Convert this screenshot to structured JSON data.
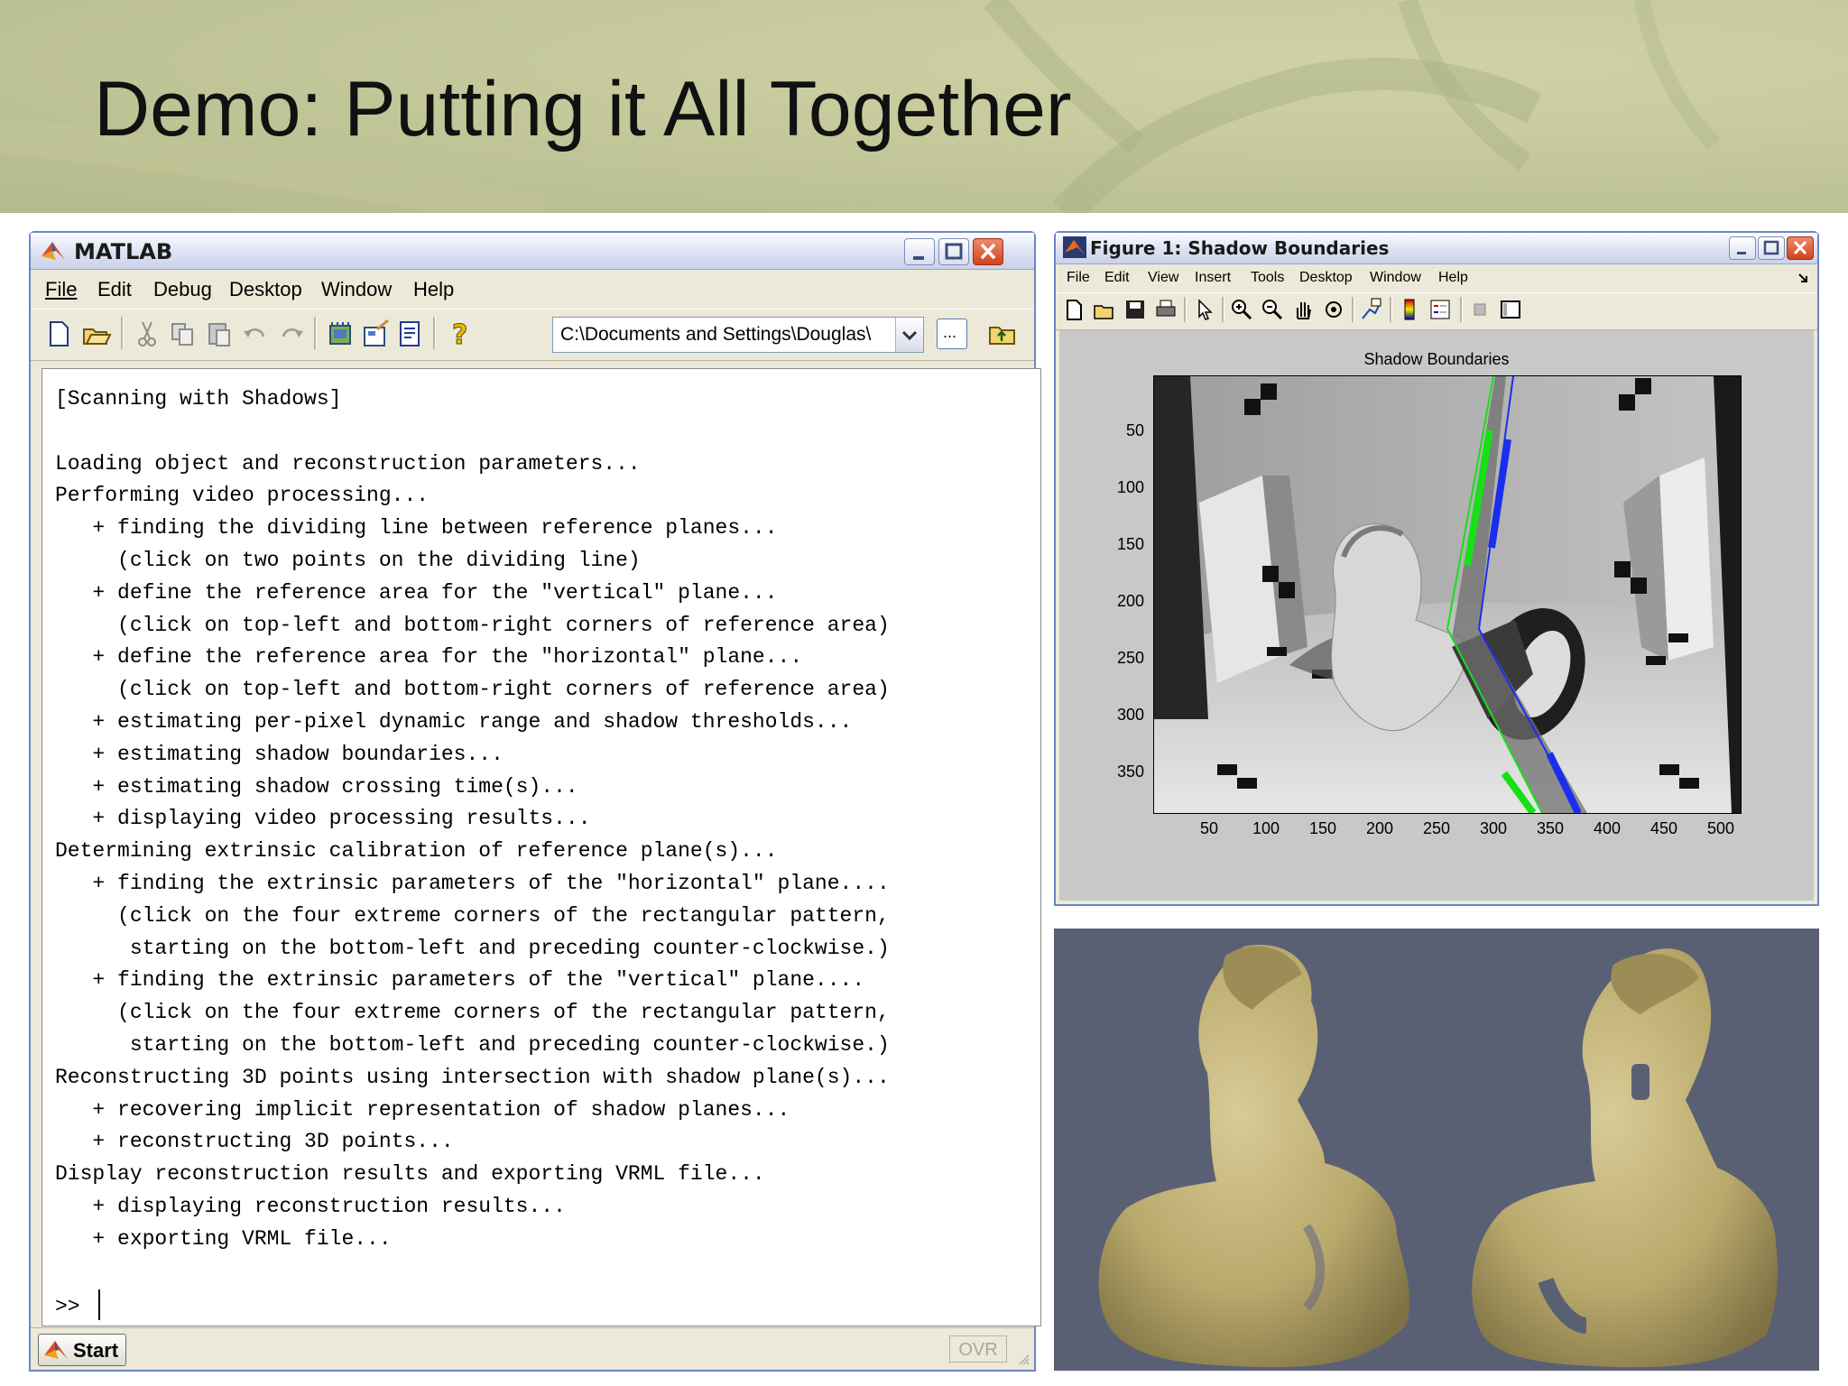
{
  "slide": {
    "title": "Demo: Putting it All Together"
  },
  "matlab": {
    "window_title": "MATLAB",
    "menu": [
      "File",
      "Edit",
      "Debug",
      "Desktop",
      "Window",
      "Help"
    ],
    "toolbar_icons": [
      "new-file-icon",
      "open-folder-icon",
      "cut-icon",
      "copy-icon",
      "paste-icon",
      "undo-icon",
      "redo-icon",
      "simulink-icon",
      "guide-icon",
      "profiler-icon",
      "help-icon"
    ],
    "current_directory": "C:\\Documents and Settings\\Douglas\\",
    "browse_label": "...",
    "output_lines": [
      "[Scanning with Shadows]",
      "",
      "Loading object and reconstruction parameters...",
      "Performing video processing...",
      "   + finding the dividing line between reference planes...",
      "     (click on two points on the dividing line)",
      "   + define the reference area for the \"vertical\" plane...",
      "     (click on top-left and bottom-right corners of reference area)",
      "   + define the reference area for the \"horizontal\" plane...",
      "     (click on top-left and bottom-right corners of reference area)",
      "   + estimating per-pixel dynamic range and shadow thresholds...",
      "   + estimating shadow boundaries...",
      "   + estimating shadow crossing time(s)...",
      "   + displaying video processing results...",
      "Determining extrinsic calibration of reference plane(s)...",
      "   + finding the extrinsic parameters of the \"horizontal\" plane....",
      "     (click on the four extreme corners of the rectangular pattern,",
      "      starting on the bottom-left and preceding counter-clockwise.)",
      "   + finding the extrinsic parameters of the \"vertical\" plane....",
      "     (click on the four extreme corners of the rectangular pattern,",
      "      starting on the bottom-left and preceding counter-clockwise.)",
      "Reconstructing 3D points using intersection with shadow plane(s)...",
      "   + recovering implicit representation of shadow planes...",
      "   + reconstructing 3D points...",
      "Display reconstruction results and exporting VRML file...",
      "   + displaying reconstruction results...",
      "   + exporting VRML file..."
    ],
    "prompt": ">>",
    "start_label": "Start",
    "ovr_label": "OVR"
  },
  "figure": {
    "window_title": "Figure 1: Shadow Boundaries",
    "menu": [
      "File",
      "Edit",
      "View",
      "Insert",
      "Tools",
      "Desktop",
      "Window",
      "Help"
    ],
    "toolbar_icons": [
      "new-figure-icon",
      "open-icon",
      "save-icon",
      "print-icon",
      "arrow-icon",
      "zoom-in-icon",
      "zoom-out-icon",
      "pan-icon",
      "rotate-icon",
      "data-cursor-icon",
      "colorbar-icon",
      "legend-icon",
      "hide-plot-tools-icon",
      "show-plot-tools-icon"
    ],
    "plot_title": "Shadow Boundaries",
    "y_ticks": [
      "50",
      "100",
      "150",
      "200",
      "250",
      "300",
      "350"
    ],
    "x_ticks": [
      "50",
      "100",
      "150",
      "200",
      "250",
      "300",
      "350",
      "400",
      "450",
      "500"
    ],
    "colors": {
      "green_line": "#18e018",
      "blue_line": "#1a2ef0"
    }
  }
}
